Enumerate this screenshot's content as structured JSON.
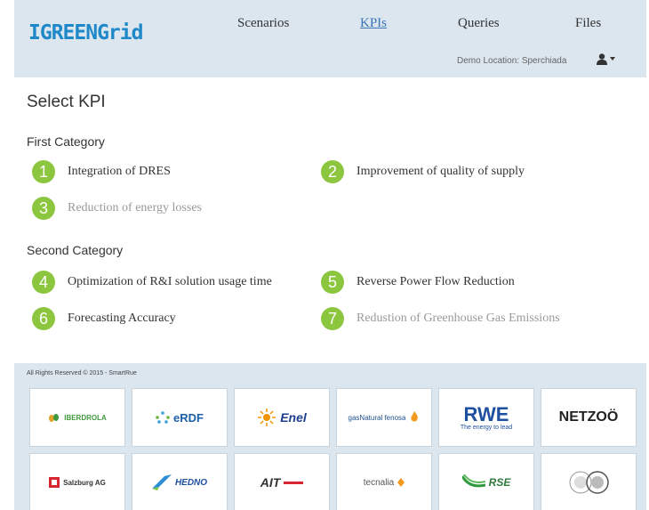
{
  "header": {
    "logo_text": "IGREENGrid",
    "nav": [
      {
        "label": "Scenarios"
      },
      {
        "label": "KPIs"
      },
      {
        "label": "Queries"
      },
      {
        "label": "Files"
      }
    ],
    "demo_location": "Demo Location: Sperchiada",
    "icons": {
      "user": "user-icon",
      "caret": "caret-down-icon"
    }
  },
  "main": {
    "title": "Select KPI",
    "categories": [
      {
        "title": "First Category",
        "kpis": [
          {
            "number": "1",
            "label": "Integration of DRES",
            "enabled": true
          },
          {
            "number": "2",
            "label": "Improvement of quality of supply",
            "enabled": true
          },
          {
            "number": "3",
            "label": "Reduction of energy losses",
            "enabled": false
          }
        ]
      },
      {
        "title": "Second Category",
        "kpis": [
          {
            "number": "4",
            "label": "Optimization of R&I solution usage time",
            "enabled": true
          },
          {
            "number": "5",
            "label": "Reverse Power Flow Reduction",
            "enabled": true
          },
          {
            "number": "6",
            "label": "Forecasting Accuracy",
            "enabled": true
          },
          {
            "number": "7",
            "label": "Redustion of Greenhouse Gas Emissions",
            "enabled": false
          }
        ]
      }
    ]
  },
  "footer": {
    "rights": "All Rights Reserved © 2015 - SmartRue",
    "partners": [
      {
        "name": "IBERDROLA"
      },
      {
        "name": "eRDF"
      },
      {
        "name": "Enel"
      },
      {
        "name": "gasNatural fenosa"
      },
      {
        "name": "RWE",
        "tagline": "The energy to lead"
      },
      {
        "name": "NETZOÖ"
      },
      {
        "name": "Salzburg AG"
      },
      {
        "name": "HEDNO"
      },
      {
        "name": "AIT"
      },
      {
        "name": "tecnalia"
      },
      {
        "name": "RSE"
      },
      {
        "name": "university-seal"
      }
    ]
  },
  "colors": {
    "header_bg": "#dbe6ef",
    "accent_green": "#8cc63f",
    "link_blue": "#3b74b8"
  }
}
